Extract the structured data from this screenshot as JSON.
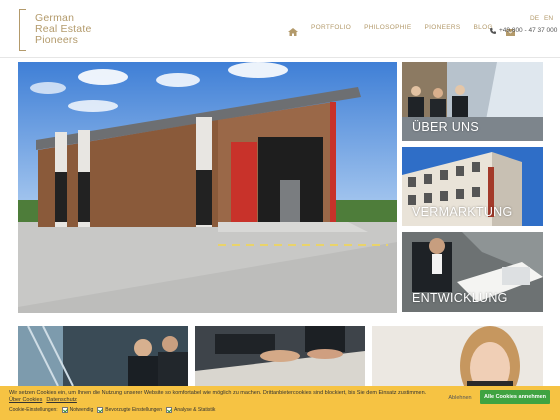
{
  "brand": {
    "line1": "German",
    "line2": "Real Estate",
    "line3": "Pioneers",
    "color": "#b39a6b"
  },
  "nav": {
    "home_icon": "home-icon",
    "items": [
      "PORTFOLIO",
      "PHILOSOPHIE",
      "PIONEERS",
      "BLOG"
    ],
    "mail_icon": "mail-icon"
  },
  "language": {
    "de": "DE",
    "en": "EN"
  },
  "contact": {
    "phone": "+49 800 - 47 37 000",
    "phone_icon": "phone-icon"
  },
  "tiles": {
    "about": "ÜBER UNS",
    "marketing": "VERMARKTUNG",
    "development": "ENTWICKLUNG"
  },
  "cookie": {
    "text": "Wir setzen Cookies ein, um Ihnen die Nutzung unserer Website so komfortabel wie möglich zu machen. Drittanbietercookies sind blockiert, bis Sie dem Einsatz zustimmen.",
    "link_about": "Über Cookies",
    "link_privacy": "Datenschutz",
    "settings_label": "Cookie-Einstellungen:",
    "options": [
      "Notwendig",
      "Bevorzugte Einstellungen",
      "Analyse & Statistik"
    ],
    "decline": "Ablehnen",
    "accept": "Alle Cookies annehmen",
    "bg": "#f6c343",
    "accept_color": "#3fa341"
  }
}
